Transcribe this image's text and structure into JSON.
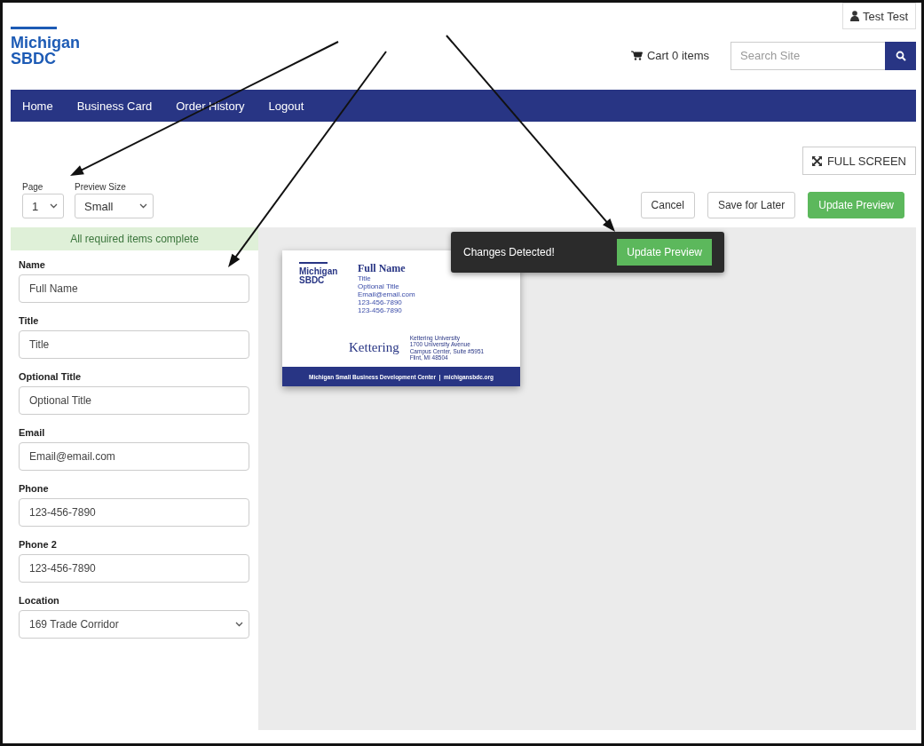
{
  "user_button": "Test Test",
  "logo": {
    "line1": "Michigan",
    "line2": "SBDC"
  },
  "cart": "Cart 0 items",
  "search": {
    "placeholder": "Search Site"
  },
  "nav": [
    {
      "label": "Home"
    },
    {
      "label": "Business Card"
    },
    {
      "label": "Order History"
    },
    {
      "label": "Logout"
    }
  ],
  "full_screen": "FULL SCREEN",
  "page_select": {
    "label": "Page",
    "value": "1"
  },
  "preview_size": {
    "label": "Preview Size",
    "value": "Small"
  },
  "actions": [
    {
      "label": "Cancel",
      "kind": "outline"
    },
    {
      "label": "Save for Later",
      "kind": "outline"
    },
    {
      "label": "Update Preview",
      "kind": "primary"
    }
  ],
  "status": "All required items complete",
  "fields": [
    {
      "label": "Name",
      "value": "Full Name",
      "kind": "text"
    },
    {
      "label": "Title",
      "value": "Title",
      "kind": "text"
    },
    {
      "label": "Optional Title",
      "value": "Optional Title",
      "kind": "text"
    },
    {
      "label": "Email",
      "value": "Email@email.com",
      "kind": "text"
    },
    {
      "label": "Phone",
      "value": "123-456-7890",
      "kind": "text"
    },
    {
      "label": "Phone 2",
      "value": "123-456-7890",
      "kind": "text"
    },
    {
      "label": "Location",
      "value": "169 Trade Corridor",
      "kind": "select"
    }
  ],
  "toast": {
    "message": "Changes Detected!",
    "button": "Update Preview"
  },
  "card": {
    "logo_line1": "Michigan",
    "logo_line2": "SBDC",
    "name": "Full Name",
    "lines": [
      "Title",
      "Optional Title",
      "Email@email.com",
      "123-456-7890",
      "123-456-7890"
    ],
    "wordmark": "Kettering",
    "address": [
      "Kettering University",
      "1700 University Avenue",
      "Campus Center, Suite #5951",
      "Flint, MI 48504"
    ],
    "footer": "Michigan Small Business Development Center  |  michigansbdc.org"
  }
}
